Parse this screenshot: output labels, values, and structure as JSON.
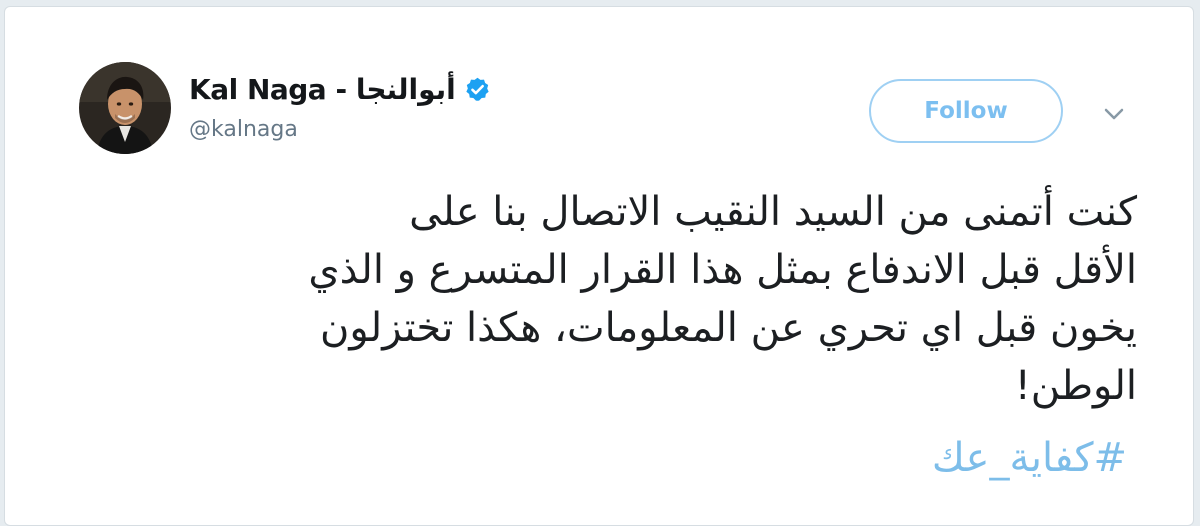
{
  "tweet": {
    "author": {
      "display_name": "Kal Naga - أبوالنجا",
      "handle": "@kalnaga",
      "verified": true,
      "avatar_icon": "profile-photo"
    },
    "follow_label": "Follow",
    "menu_icon": "chevron-down-icon",
    "text": "كنت أتمنى من السيد النقيب الاتصال بنا على\nالأقل قبل الاندفاع بمثل هذا القرار المتسرع و الذي\nيخون قبل اي تحري عن المعلومات،  هكذا تختزلون\nالوطن!",
    "hashtag": "#كفاية_عك"
  },
  "colors": {
    "accent": "#1da1f2",
    "follow_text": "#7cbff0",
    "hashtag": "#7dbde9",
    "text": "#1c1f22",
    "secondary": "#657786"
  }
}
